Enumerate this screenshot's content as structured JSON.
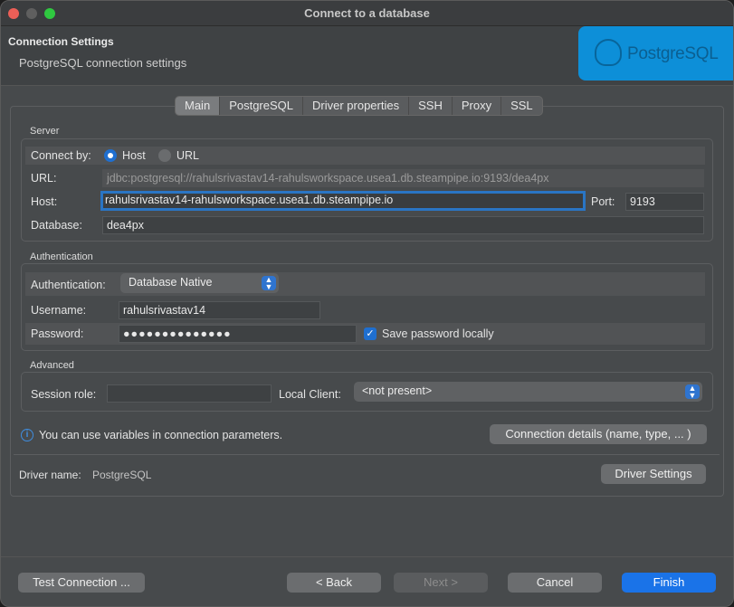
{
  "window": {
    "title": "Connect to a database"
  },
  "header": {
    "title": "Connection Settings",
    "subtitle": "PostgreSQL connection settings",
    "logo_text": "PostgreSQL"
  },
  "tabs": [
    "Main",
    "PostgreSQL",
    "Driver properties",
    "SSH",
    "Proxy",
    "SSL"
  ],
  "server": {
    "group_label": "Server",
    "connect_by_label": "Connect by:",
    "host_option": "Host",
    "url_option": "URL",
    "url_label": "URL:",
    "url_value": "jdbc:postgresql://rahulsrivastav14-rahulsworkspace.usea1.db.steampipe.io:9193/dea4px",
    "host_label": "Host:",
    "host_value": "rahulsrivastav14-rahulsworkspace.usea1.db.steampipe.io",
    "port_label": "Port:",
    "port_value": "9193",
    "database_label": "Database:",
    "database_value": "dea4px"
  },
  "auth": {
    "group_label": "Authentication",
    "auth_label": "Authentication:",
    "auth_value": "Database Native",
    "username_label": "Username:",
    "username_value": "rahulsrivastav14",
    "password_label": "Password:",
    "password_value": "●●●●●●●●●●●●●●",
    "save_password_label": "Save password locally"
  },
  "advanced": {
    "group_label": "Advanced",
    "session_role_label": "Session role:",
    "session_role_value": "",
    "local_client_label": "Local Client:",
    "local_client_value": "<not present>"
  },
  "info_text": "You can use variables in connection parameters.",
  "connection_details_button": "Connection details (name, type, ... )",
  "driver": {
    "label": "Driver name:",
    "value": "PostgreSQL",
    "settings_button": "Driver Settings"
  },
  "footer": {
    "test_button": "Test Connection ...",
    "back_button": "< Back",
    "next_button": "Next >",
    "cancel_button": "Cancel",
    "finish_button": "Finish"
  },
  "colors": {
    "accent": "#1a73e8",
    "logo_bg": "#0d8fd8",
    "focus_ring": "#2a75c4"
  }
}
